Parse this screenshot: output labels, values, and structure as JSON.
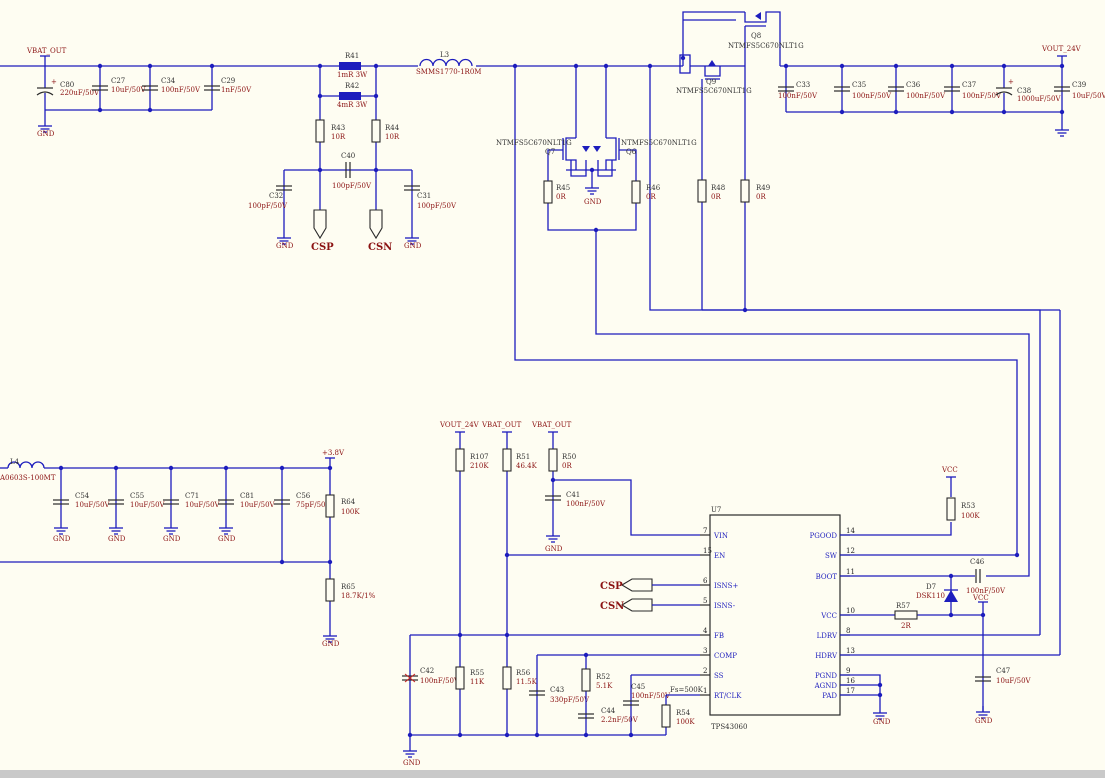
{
  "nets": {
    "vbat_out": "VBAT_OUT",
    "vout_24v": "VOUT_24V",
    "gnd": "GND",
    "vcc": "VCC",
    "v3_8": "+3.8V",
    "csp": "CSP",
    "csn": "CSN"
  },
  "parts": {
    "C80": {
      "ref": "C80",
      "val": "220uF/50V"
    },
    "C27": {
      "ref": "C27",
      "val": "10uF/50V"
    },
    "C34": {
      "ref": "C34",
      "val": "100nF/50V"
    },
    "C29": {
      "ref": "C29",
      "val": "1nF/50V"
    },
    "R41": {
      "ref": "R41",
      "val": "1mR 3W"
    },
    "R42": {
      "ref": "R42",
      "val": "4mR 3W"
    },
    "R43": {
      "ref": "R43",
      "val": "10R"
    },
    "R44": {
      "ref": "R44",
      "val": "10R"
    },
    "C40": {
      "ref": "C40",
      "val": "100pF/50V"
    },
    "C32": {
      "ref": "C32",
      "val": "100pF/50V"
    },
    "C31": {
      "ref": "C31",
      "val": "100pF/50V"
    },
    "L3": {
      "ref": "L3",
      "val": "SMMS1770-1R0M"
    },
    "Q7": {
      "ref": "Q7",
      "val": "NTMFS5C670NLT1G"
    },
    "Q6": {
      "ref": "Q6",
      "val": "NTMFS5C670NLT1G"
    },
    "Q8": {
      "ref": "Q8",
      "val": "NTMFS5C670NLT1G"
    },
    "Q9": {
      "ref": "Q9",
      "val": "NTMFS5C670NLT1G"
    },
    "R45": {
      "ref": "R45",
      "val": "0R"
    },
    "R46": {
      "ref": "R46",
      "val": "0R"
    },
    "R48": {
      "ref": "R48",
      "val": "0R"
    },
    "R49": {
      "ref": "R49",
      "val": "0R"
    },
    "C33": {
      "ref": "C33",
      "val": "100nF/50V"
    },
    "C35": {
      "ref": "C35",
      "val": "100nF/50V"
    },
    "C36": {
      "ref": "C36",
      "val": "100nF/50V"
    },
    "C37": {
      "ref": "C37",
      "val": "100nF/50V"
    },
    "C38": {
      "ref": "C38",
      "val": "1000uF/50V"
    },
    "C39": {
      "ref": "C39",
      "val": "10uF/50V"
    },
    "L4": {
      "ref": "L4",
      "val": "A0603S-100MT"
    },
    "C54": {
      "ref": "C54",
      "val": "10uF/50V"
    },
    "C55": {
      "ref": "C55",
      "val": "10uF/50V"
    },
    "C71": {
      "ref": "C71",
      "val": "10uF/50V"
    },
    "C81": {
      "ref": "C81",
      "val": "10uF/50V"
    },
    "C56": {
      "ref": "C56",
      "val": "75pF/50V"
    },
    "R64": {
      "ref": "R64",
      "val": "100K"
    },
    "R65": {
      "ref": "R65",
      "val": "18.7K/1%"
    },
    "R107": {
      "ref": "R107",
      "val": "210K"
    },
    "R51": {
      "ref": "R51",
      "val": "46.4K"
    },
    "R50": {
      "ref": "R50",
      "val": "0R"
    },
    "C41": {
      "ref": "C41",
      "val": "100nF/50V"
    },
    "C42": {
      "ref": "C42",
      "val": "100nF/50V"
    },
    "R55": {
      "ref": "R55",
      "val": "11K"
    },
    "R56": {
      "ref": "R56",
      "val": "11.5K"
    },
    "C43": {
      "ref": "C43",
      "val": "330pF/50V"
    },
    "R52": {
      "ref": "R52",
      "val": "5.1K"
    },
    "C44": {
      "ref": "C44",
      "val": "2.2nF/50V"
    },
    "C45": {
      "ref": "C45",
      "val": "100nF/50V"
    },
    "R54": {
      "ref": "R54",
      "val": "100K"
    },
    "R53": {
      "ref": "R53",
      "val": "100K"
    },
    "C46": {
      "ref": "C46",
      "val": "100nF/50V"
    },
    "D7": {
      "ref": "D7",
      "val": "DSK110"
    },
    "R57": {
      "ref": "R57",
      "val": "2R"
    },
    "C47": {
      "ref": "C47",
      "val": "10uF/50V"
    }
  },
  "ic": {
    "ref": "U7",
    "name": "TPS43060",
    "left_pins": [
      {
        "num": "7",
        "name": "VIN"
      },
      {
        "num": "15",
        "name": "EN"
      },
      {
        "num": "6",
        "name": "ISNS+"
      },
      {
        "num": "5",
        "name": "ISNS-"
      },
      {
        "num": "4",
        "name": "FB"
      },
      {
        "num": "3",
        "name": "COMP"
      },
      {
        "num": "2",
        "name": "SS"
      },
      {
        "num": "1",
        "name": "RT/CLK"
      }
    ],
    "right_pins": [
      {
        "num": "14",
        "name": "PGOOD"
      },
      {
        "num": "12",
        "name": "SW"
      },
      {
        "num": "11",
        "name": "BOOT"
      },
      {
        "num": "10",
        "name": "VCC"
      },
      {
        "num": "8",
        "name": "LDRV"
      },
      {
        "num": "13",
        "name": "HDRV"
      },
      {
        "num": "9",
        "name": "PGND"
      },
      {
        "num": "16",
        "name": "AGND"
      },
      {
        "num": "17",
        "name": "PAD"
      }
    ]
  },
  "notes": {
    "fs": "Fs=500K"
  }
}
